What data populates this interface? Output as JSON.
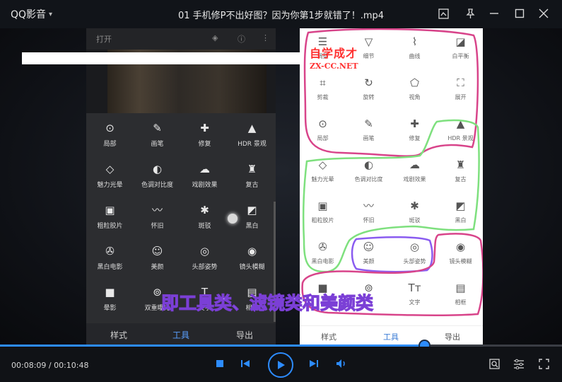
{
  "app": {
    "name": "QQ影音",
    "file_title": "01 手机修P不出好图？因为你第1步就错了！.mp4"
  },
  "left_screen": {
    "topbar_title": "打开",
    "tools": [
      {
        "label": "局部",
        "icon": "⊙"
      },
      {
        "label": "画笔",
        "icon": "✎"
      },
      {
        "label": "修复",
        "icon": "✚"
      },
      {
        "label": "HDR 景观",
        "icon": "▲"
      },
      {
        "label": "魅力光晕",
        "icon": "◇"
      },
      {
        "label": "色调对比度",
        "icon": "◐"
      },
      {
        "label": "戏剧效果",
        "icon": "☁"
      },
      {
        "label": "复古",
        "icon": "♜"
      },
      {
        "label": "粗粒胶片",
        "icon": "▣"
      },
      {
        "label": "怀旧",
        "icon": "〰"
      },
      {
        "label": "斑驳",
        "icon": "✱"
      },
      {
        "label": "黑白",
        "icon": "◩"
      },
      {
        "label": "黑白电影",
        "icon": "✇"
      },
      {
        "label": "美颜",
        "icon": "☺"
      },
      {
        "label": "头部姿势",
        "icon": "◎"
      },
      {
        "label": "镜头模糊",
        "icon": "◉"
      },
      {
        "label": "晕影",
        "icon": "■"
      },
      {
        "label": "双重曝光",
        "icon": "⊚"
      },
      {
        "label": "文字",
        "icon": "T"
      },
      {
        "label": "相框",
        "icon": "▤"
      }
    ],
    "tabs": [
      "样式",
      "工具",
      "导出"
    ],
    "active_tab": "工具"
  },
  "right_screen": {
    "tools": [
      {
        "label": "调整",
        "icon": "☰"
      },
      {
        "label": "细节",
        "icon": "▽"
      },
      {
        "label": "曲线",
        "icon": "⌇"
      },
      {
        "label": "白平衡",
        "icon": "◪"
      },
      {
        "label": "剪裁",
        "icon": "⌗"
      },
      {
        "label": "旋转",
        "icon": "↻"
      },
      {
        "label": "视角",
        "icon": "⬠"
      },
      {
        "label": "展开",
        "icon": "⛶"
      },
      {
        "label": "局部",
        "icon": "⊙"
      },
      {
        "label": "画笔",
        "icon": "✎"
      },
      {
        "label": "修复",
        "icon": "✚"
      },
      {
        "label": "HDR 景观",
        "icon": "▲"
      },
      {
        "label": "魅力光晕",
        "icon": "◇"
      },
      {
        "label": "色调对比度",
        "icon": "◐"
      },
      {
        "label": "戏剧效果",
        "icon": "☁"
      },
      {
        "label": "复古",
        "icon": "♜"
      },
      {
        "label": "粗粒胶片",
        "icon": "▣"
      },
      {
        "label": "怀旧",
        "icon": "〰"
      },
      {
        "label": "斑驳",
        "icon": "✱"
      },
      {
        "label": "黑白",
        "icon": "◩"
      },
      {
        "label": "黑白电影",
        "icon": "✇"
      },
      {
        "label": "美颜",
        "icon": "☺"
      },
      {
        "label": "头部姿势",
        "icon": "◎"
      },
      {
        "label": "镜头模糊",
        "icon": "◉"
      },
      {
        "label": "",
        "icon": "■"
      },
      {
        "label": "",
        "icon": "⊚"
      },
      {
        "label": "文字",
        "icon": "Tт"
      },
      {
        "label": "相框",
        "icon": "▤"
      }
    ],
    "tabs": [
      "样式",
      "工具",
      "导出"
    ],
    "active_tab": "工具"
  },
  "watermark": {
    "cn": "自学成才",
    "en": "ZX-CC.NET"
  },
  "subtitle": "即工具类、滤镜类和美颜类",
  "player": {
    "current_time": "00:08:09",
    "total_time": "00:10:48",
    "time_text": "00:08:09 / 00:10:48",
    "progress": 0.755
  },
  "colors": {
    "accent": "#2d8cff",
    "annotation_pink": "#d8448a",
    "annotation_green": "#7ee07e",
    "annotation_purple": "#8a5cf0",
    "watermark": "#ff3030"
  }
}
